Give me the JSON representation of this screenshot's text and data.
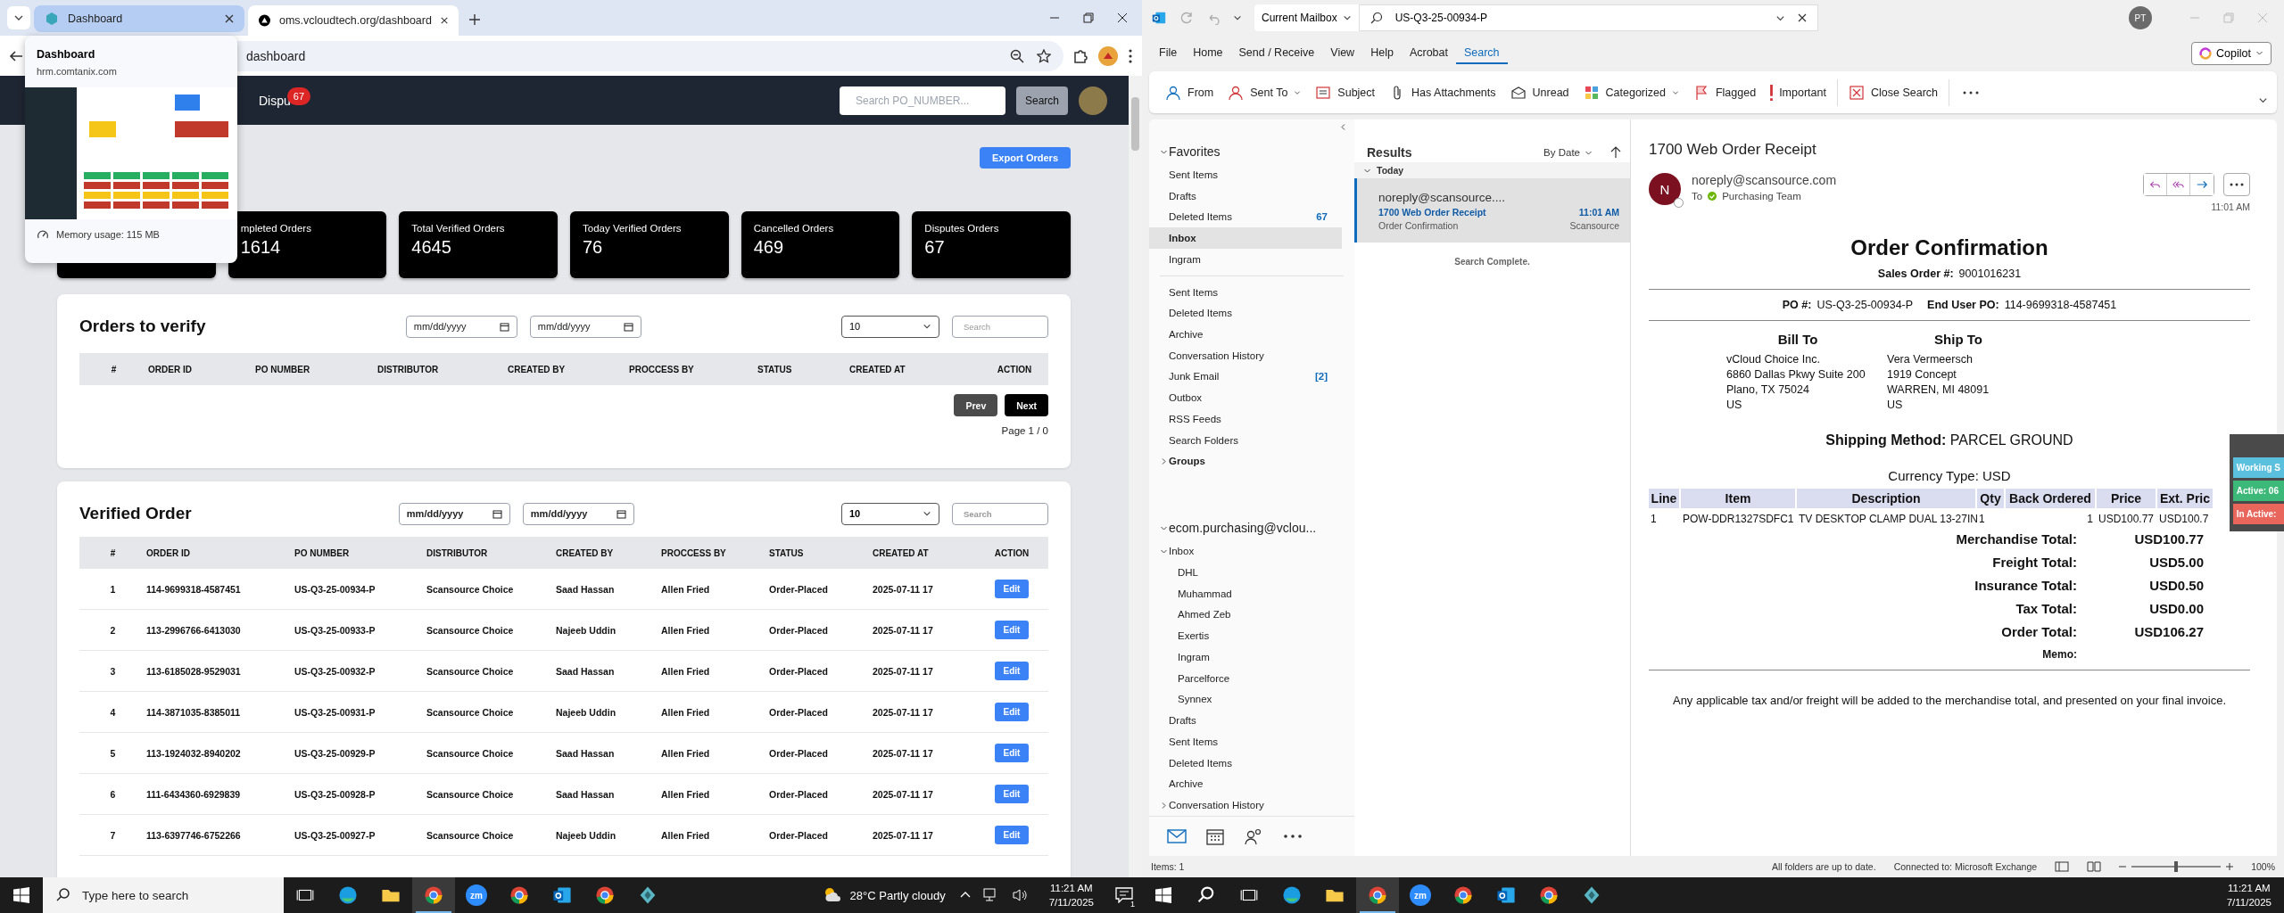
{
  "left_screen": {
    "browser": {
      "tabs": [
        {
          "title": "Dashboard",
          "selected": false,
          "hovered": true
        },
        {
          "title": "oms.vcloudtech.org/dashboard",
          "selected": true,
          "hovered": false
        }
      ],
      "address": "dashboard",
      "tab_preview": {
        "title": "Dashboard",
        "url": "hrm.comtanix.com",
        "memory": "Memory usage: 115 MB"
      }
    },
    "page": {
      "nav": {
        "disputes_label": "Dispu",
        "disputes_badge": "67",
        "search_placeholder": "Search PO_NUMBER...",
        "search_button": "Search"
      },
      "export_button": "Export Orders",
      "stats": [
        {
          "label": "mpleted Orders",
          "value": "1614"
        },
        {
          "label": "Total Verified Orders",
          "value": "4645"
        },
        {
          "label": "Today Verified Orders",
          "value": "76"
        },
        {
          "label": "Cancelled Orders",
          "value": "469"
        },
        {
          "label": "Disputes Orders",
          "value": "67"
        }
      ],
      "orders_to_verify": {
        "title": "Orders to verify",
        "date_from": "mm/dd/yyyy",
        "date_to": "mm/dd/yyyy",
        "page_size": "10",
        "search_placeholder": "Search",
        "columns": [
          "#",
          "ORDER ID",
          "PO NUMBER",
          "DISTRIBUTOR",
          "CREATED BY",
          "PROCCESS BY",
          "STATUS",
          "CREATED AT",
          "ACTION"
        ],
        "prev_button": "Prev",
        "next_button": "Next",
        "page_info": "Page 1 / 0"
      },
      "verified_orders": {
        "title": "Verified Order",
        "date_from": "mm/dd/yyyy",
        "date_to": "mm/dd/yyyy",
        "page_size": "10",
        "search_placeholder": "Search",
        "columns": [
          "#",
          "ORDER ID",
          "PO NUMBER",
          "DISTRIBUTOR",
          "CREATED BY",
          "PROCCESS BY",
          "STATUS",
          "CREATED AT",
          "ACTION"
        ],
        "rows": [
          [
            "1",
            "114-9699318-4587451",
            "US-Q3-25-00934-P",
            "Scansource Choice",
            "Saad Hassan",
            "Allen Fried",
            "Order-Placed",
            "2025-07-11 17",
            "Edit"
          ],
          [
            "2",
            "113-2996766-6413030",
            "US-Q3-25-00933-P",
            "Scansource Choice",
            "Najeeb Uddin",
            "Allen Fried",
            "Order-Placed",
            "2025-07-11 17",
            "Edit"
          ],
          [
            "3",
            "113-6185028-9529031",
            "US-Q3-25-00932-P",
            "Scansource Choice",
            "Saad Hassan",
            "Allen Fried",
            "Order-Placed",
            "2025-07-11 17",
            "Edit"
          ],
          [
            "4",
            "114-3871035-8385011",
            "US-Q3-25-00931-P",
            "Scansource Choice",
            "Najeeb Uddin",
            "Allen Fried",
            "Order-Placed",
            "2025-07-11 17",
            "Edit"
          ],
          [
            "5",
            "113-1924032-8940202",
            "US-Q3-25-00929-P",
            "Scansource Choice",
            "Saad Hassan",
            "Allen Fried",
            "Order-Placed",
            "2025-07-11 17",
            "Edit"
          ],
          [
            "6",
            "111-6434360-6929839",
            "US-Q3-25-00928-P",
            "Scansource Choice",
            "Saad Hassan",
            "Allen Fried",
            "Order-Placed",
            "2025-07-11 17",
            "Edit"
          ],
          [
            "7",
            "113-6397746-6752266",
            "US-Q3-25-00927-P",
            "Scansource Choice",
            "Najeeb Uddin",
            "Allen Fried",
            "Order-Placed",
            "2025-07-11 17",
            "Edit"
          ]
        ]
      }
    },
    "taskbar": {
      "search_placeholder": "Type here to search",
      "apps": [
        {
          "kind": "taskview",
          "active": false
        },
        {
          "kind": "edge",
          "active": false
        },
        {
          "kind": "explorer",
          "active": false
        },
        {
          "kind": "chrome",
          "active": true
        },
        {
          "kind": "zoom",
          "label": "zm",
          "active": false
        },
        {
          "kind": "chrome",
          "active": false
        },
        {
          "kind": "outlook",
          "active": false
        },
        {
          "kind": "chrome",
          "active": false
        },
        {
          "kind": "app",
          "active": false
        }
      ],
      "weather": "28°C  Partly cloudy",
      "time": "11:21 AM",
      "date": "7/11/2025",
      "notifications": "1"
    }
  },
  "right_screen": {
    "outlook": {
      "scope": "Current Mailbox",
      "search_value": "US-Q3-25-00934-P",
      "account_initials": "PT",
      "menu": [
        {
          "label": "File",
          "selected": false
        },
        {
          "label": "Home",
          "selected": false
        },
        {
          "label": "Send / Receive",
          "selected": false
        },
        {
          "label": "View",
          "selected": false
        },
        {
          "label": "Help",
          "selected": false
        },
        {
          "label": "Acrobat",
          "selected": false
        },
        {
          "label": "Search",
          "selected": true
        }
      ],
      "copilot": "Copilot",
      "ribbon": [
        {
          "kind": "from",
          "label": "From",
          "dropdown": false
        },
        {
          "kind": "sent_to",
          "label": "Sent To",
          "dropdown": true
        },
        {
          "kind": "subject",
          "label": "Subject",
          "dropdown": false
        },
        {
          "kind": "attachments",
          "label": "Has Attachments",
          "dropdown": false
        },
        {
          "kind": "unread",
          "label": "Unread",
          "dropdown": false
        },
        {
          "kind": "categorized",
          "label": "Categorized",
          "dropdown": true
        },
        {
          "kind": "flagged",
          "label": "Flagged",
          "dropdown": false
        },
        {
          "kind": "important",
          "label": "Important",
          "dropdown": false
        },
        {
          "kind": "close_search",
          "label": "Close Search",
          "dropdown": false
        }
      ],
      "folders": [
        {
          "label": "Favorites",
          "expanded": true,
          "children": [
            {
              "label": "Sent Items",
              "selected": false
            },
            {
              "label": "Drafts",
              "selected": false
            },
            {
              "label": "Deleted Items",
              "count": "67",
              "selected": false
            },
            {
              "label": "Inbox",
              "selected": true
            },
            {
              "label": "Ingram",
              "selected": false
            }
          ]
        },
        {
          "label": "Sent Items",
          "selected": false
        },
        {
          "label": "Deleted Items",
          "selected": false
        },
        {
          "label": "Archive",
          "selected": false
        },
        {
          "label": "Conversation History",
          "selected": false
        },
        {
          "label": "Junk Email",
          "count": "[2]",
          "selected": false
        },
        {
          "label": "Outbox",
          "selected": false
        },
        {
          "label": "RSS Feeds",
          "selected": false
        },
        {
          "label": "Search Folders",
          "selected": false
        },
        {
          "label": "Groups",
          "expanded": false
        },
        {
          "label": "ecom.purchasing@vclou...",
          "expanded": true,
          "children": [
            {
              "label": "Inbox",
              "expanded": true,
              "selected": false,
              "children": [
                {
                  "label": "DHL",
                  "selected": false
                },
                {
                  "label": "Muhammad",
                  "selected": false
                },
                {
                  "label": "Ahmed Zeb",
                  "selected": false
                },
                {
                  "label": "Exertis",
                  "selected": false
                },
                {
                  "label": "Ingram",
                  "selected": false
                },
                {
                  "label": "Parcelforce",
                  "selected": false
                },
                {
                  "label": "Synnex",
                  "selected": false
                }
              ]
            },
            {
              "label": "Drafts",
              "selected": false
            },
            {
              "label": "Sent Items",
              "selected": false
            },
            {
              "label": "Deleted Items",
              "selected": false
            },
            {
              "label": "Archive",
              "selected": false
            },
            {
              "label": "Conversation History",
              "expanded": false,
              "selected": false
            }
          ]
        }
      ],
      "results": {
        "title": "Results",
        "sort": "By Date",
        "group": {
          "label": "Today",
          "expanded": true
        },
        "messages": [
          {
            "sender": "noreply@scansource....",
            "subject": "1700 Web Order Receipt",
            "preview": "Order Confirmation",
            "time": "11:01 AM",
            "folder": "Scansource",
            "selected": true
          }
        ],
        "footer": "Search Complete."
      },
      "reading": {
        "subject": "1700 Web Order Receipt",
        "avatar": "N",
        "sender": "noreply@scansource.com",
        "to_label": "To",
        "to": "Purchasing Team",
        "time": "11:01 AM",
        "body": {
          "title": "Order Confirmation",
          "sales_order_label": "Sales Order #:",
          "sales_order": "9001016231",
          "po_label": "PO #:",
          "po": "US-Q3-25-00934-P",
          "end_user_label": "End User PO:",
          "end_user_po": "114-9699318-4587451",
          "bill_to": {
            "title": "Bill To",
            "lines": [
              "vCloud Choice Inc.",
              "6860 Dallas Pkwy Suite 200",
              "Plano, TX 75024",
              "US"
            ]
          },
          "ship_to": {
            "title": "Ship To",
            "lines": [
              "Vera Vermeersch",
              "1919 Concept",
              "WARREN, MI 48091",
              "US"
            ]
          },
          "shipping_label": "Shipping Method:",
          "shipping": "PARCEL GROUND",
          "currency": "Currency Type: USD",
          "columns": [
            "Line",
            "Item",
            "Description",
            "Qty",
            "Back Ordered",
            "Price",
            "Ext. Pric"
          ],
          "rows": [
            [
              "1",
              "POW-DDR1327SDFC1",
              "TV DESKTOP CLAMP DUAL 13-27IN",
              "1",
              "1",
              "USD100.77",
              "USD100.7"
            ]
          ],
          "totals": [
            {
              "label": "Merchandise Total:",
              "value": "USD100.77"
            },
            {
              "label": "Freight Total:",
              "value": "USD5.00"
            },
            {
              "label": "Insurance Total:",
              "value": "USD0.50"
            },
            {
              "label": "Tax Total:",
              "value": "USD0.00"
            },
            {
              "label": "Order Total:",
              "value": "USD106.27"
            }
          ],
          "memo_label": "Memo:",
          "footer": "Any applicable tax and/or freight will be added to the merchandise total, and presented on your final invoice."
        }
      },
      "status_widget": [
        {
          "label": "Working S",
          "color": "#5bc0de"
        },
        {
          "label": "Active: 06",
          "color": "#3cb878"
        },
        {
          "label": "In Active:",
          "color": "#e8665c"
        }
      ],
      "status_bar": {
        "items": "Items: 1",
        "sync": "All folders are up to date.",
        "connection": "Connected to: Microsoft Exchange",
        "zoom_slider": {
          "level": 0.5
        },
        "zoom": "100%"
      }
    },
    "taskbar": {
      "apps": [
        {
          "kind": "search",
          "active": false
        },
        {
          "kind": "taskview",
          "active": false
        },
        {
          "kind": "edge",
          "active": false
        },
        {
          "kind": "explorer",
          "active": false
        },
        {
          "kind": "chrome",
          "active": true
        },
        {
          "kind": "zoom",
          "label": "zm",
          "active": false
        },
        {
          "kind": "chrome",
          "active": false
        },
        {
          "kind": "outlook",
          "active": false
        },
        {
          "kind": "chrome",
          "active": false
        },
        {
          "kind": "app",
          "active": false
        }
      ],
      "time": "11:21 AM",
      "date": "7/11/2025"
    }
  }
}
